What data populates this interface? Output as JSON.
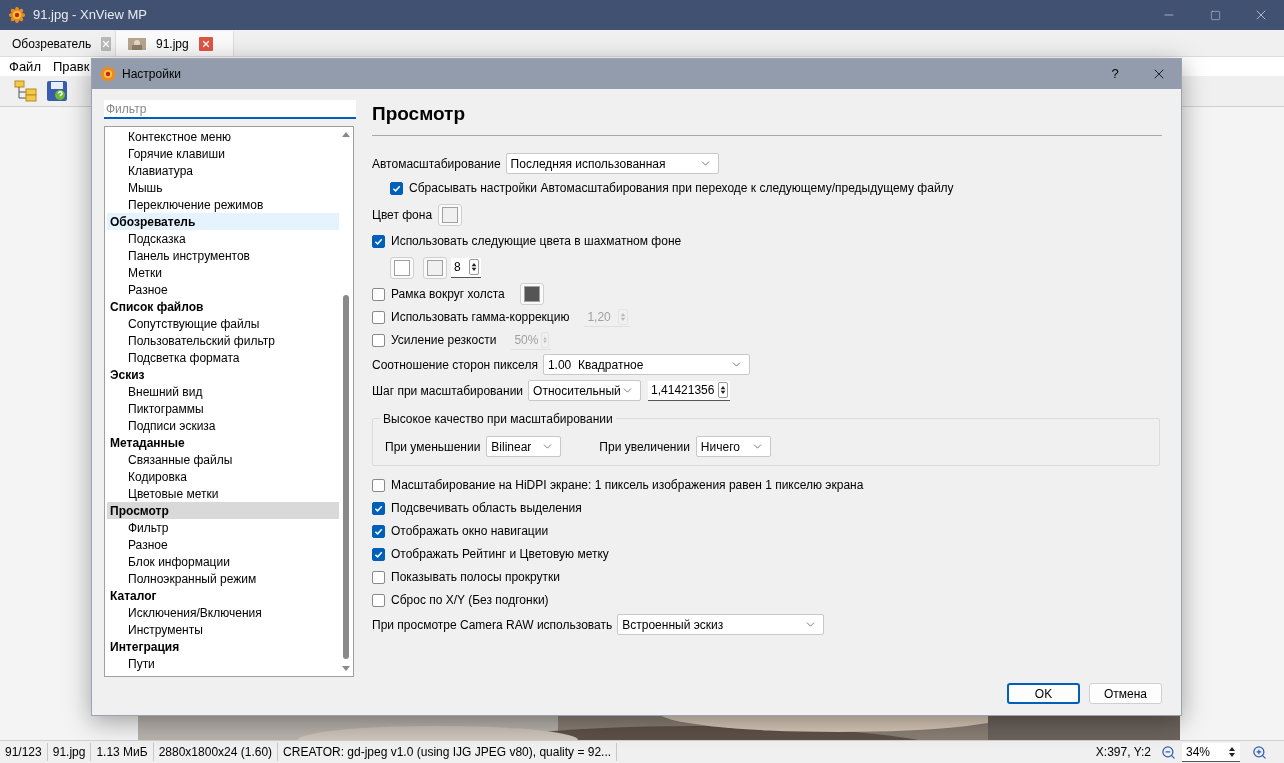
{
  "window": {
    "title": "91.jpg - XnView MP"
  },
  "tabs": [
    {
      "label": "Обозреватель",
      "selected": false
    },
    {
      "label": "91.jpg",
      "selected": true
    }
  ],
  "menu": [
    "Файл",
    "Правк"
  ],
  "dialog": {
    "title": "Настройки",
    "help": "?",
    "filter": {
      "placeholder": "Фильтр"
    },
    "tree": [
      {
        "children": [
          {
            "label": "Контекстное меню",
            "selected": false
          },
          {
            "label": "Горячие клавиши",
            "selected": false
          },
          {
            "label": "Клавиатура",
            "selected": false
          },
          {
            "label": "Мышь",
            "selected": false
          },
          {
            "label": "Переключение режимов",
            "selected": false
          }
        ]
      },
      {
        "label": "Обозреватель",
        "selected": false,
        "hovered": true,
        "children": [
          {
            "label": "Подсказка",
            "selected": false
          },
          {
            "label": "Панель инструментов",
            "selected": false
          },
          {
            "label": "Метки",
            "selected": false
          },
          {
            "label": "Разное",
            "selected": false
          }
        ]
      },
      {
        "label": "Список файлов",
        "selected": false,
        "hovered": false,
        "children": [
          {
            "label": "Сопутствующие файлы",
            "selected": false
          },
          {
            "label": "Пользовательский фильтр",
            "selected": false
          },
          {
            "label": "Подсветка формата",
            "selected": false
          }
        ]
      },
      {
        "label": "Эскиз",
        "selected": false,
        "hovered": false,
        "children": [
          {
            "label": "Внешний вид",
            "selected": false
          },
          {
            "label": "Пиктограммы",
            "selected": false
          },
          {
            "label": "Подписи эскиза",
            "selected": false
          }
        ]
      },
      {
        "label": "Метаданные",
        "selected": false,
        "hovered": false,
        "children": [
          {
            "label": "Связанные файлы",
            "selected": false
          },
          {
            "label": "Кодировка",
            "selected": false
          },
          {
            "label": "Цветовые метки",
            "selected": false
          }
        ]
      },
      {
        "label": "Просмотр",
        "selected": true,
        "hovered": false,
        "children": [
          {
            "label": "Фильтр",
            "selected": false
          },
          {
            "label": "Разное",
            "selected": false
          },
          {
            "label": "Блок информации",
            "selected": false
          },
          {
            "label": "Полноэкранный режим",
            "selected": false
          }
        ]
      },
      {
        "label": "Каталог",
        "selected": false,
        "hovered": false,
        "children": [
          {
            "label": "Исключения/Включения",
            "selected": false
          },
          {
            "label": "Инструменты",
            "selected": false
          }
        ]
      },
      {
        "label": "Интеграция",
        "selected": false,
        "hovered": false,
        "children": [
          {
            "label": "Пути",
            "selected": false
          }
        ]
      }
    ],
    "heading": "Просмотр",
    "rows": [
      {
        "kind": "select",
        "label": "Автомасштабирование",
        "value": "Последняя использованная",
        "children": [
          {
            "kind": "checkbox",
            "label": "Сбрасывать настройки Автомасштабирования при переходе к следующему/предыдущему файлу",
            "checked": true
          }
        ]
      },
      {
        "kind": "color",
        "label": "Цвет фона",
        "color": "#f0f0f0"
      },
      {
        "kind": "checkbox",
        "label": "Использовать следующие цвета в шахматном фоне",
        "checked": true,
        "children": [
          {
            "kind": "swatches",
            "colors": [
              {
                "color": "#ffffff"
              },
              {
                "color": "#f0f0f0"
              }
            ],
            "spin": {
              "value": "8",
              "disabled": false
            }
          }
        ]
      },
      {
        "kind": "checkbox",
        "label": "Рамка вокруг холста",
        "checked": false,
        "color": "#555555"
      },
      {
        "kind": "checkbox",
        "label": "Использовать гамма-коррекцию",
        "checked": false,
        "spin": {
          "value": "1,20",
          "disabled": true
        }
      },
      {
        "kind": "checkbox",
        "label": "Усиление резкости",
        "checked": false,
        "spin": {
          "value": "50%",
          "disabled": true
        }
      },
      {
        "kind": "select",
        "label": "Соотношение сторон пикселя",
        "value": "1.00  Квадратное"
      },
      {
        "kind": "select",
        "label": "Шаг при масштабировании",
        "value": "Относительный",
        "spin": {
          "value": "1,41421356",
          "disabled": false
        }
      },
      {
        "kind": "group",
        "label": "Высокое качество при масштабировании",
        "fields": [
          {
            "label": "При уменьшении",
            "value": "Bilinear"
          },
          {
            "label": "При увеличении",
            "value": "Ничего"
          }
        ]
      },
      {
        "kind": "checkbox",
        "label": "Масштабирование на HiDPI экране: 1 пиксель изображения равен 1 пикселю экрана",
        "checked": false
      },
      {
        "kind": "checkbox",
        "label": "Подсвечивать область выделения",
        "checked": true
      },
      {
        "kind": "checkbox",
        "label": "Отображать окно навигации",
        "checked": true
      },
      {
        "kind": "checkbox",
        "label": "Отображать Рейтинг и Цветовую метку",
        "checked": true
      },
      {
        "kind": "checkbox",
        "label": "Показывать полосы прокрутки",
        "checked": false
      },
      {
        "kind": "checkbox",
        "label": "Сброс по X/Y (Без подгонки)",
        "checked": false
      },
      {
        "kind": "select",
        "label": "При просмотре Camera RAW использовать",
        "value": "Встроенный эскиз"
      }
    ],
    "buttons": [
      {
        "label": "OK",
        "default": true
      },
      {
        "label": "Отмена",
        "default": false
      }
    ]
  },
  "status_bar": {
    "items": [
      "91/123",
      "91.jpg",
      "1.13 МиБ",
      "2880x1800x24 (1.60)",
      "CREATOR: gd-jpeg v1.0 (using IJG JPEG v80), quality = 92..."
    ],
    "position": "X:397, Y:2",
    "zoom": "34%"
  }
}
